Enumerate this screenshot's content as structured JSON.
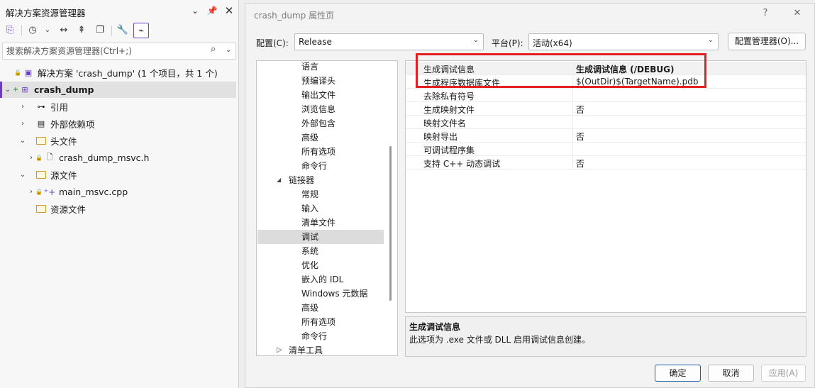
{
  "solution_explorer": {
    "title": "解决方案资源管理器",
    "header_icons": [
      "chevron-down-icon",
      "pin-icon",
      "close-icon"
    ],
    "toolbar_icons": [
      "sync-views-icon",
      "history-icon",
      "dropdown-icon",
      "back-forward-icon",
      "collapse-all-icon",
      "copy-icon",
      "properties-wrench-icon",
      "preview-selected-icon"
    ],
    "search_placeholder": "搜索解决方案资源管理器(Ctrl+;)",
    "tree": [
      {
        "label": "解决方案 'crash_dump' (1 个项目，共 1 个)"
      },
      {
        "label": "crash_dump"
      },
      {
        "label": "引用"
      },
      {
        "label": "外部依赖项"
      },
      {
        "label": "头文件"
      },
      {
        "label": "crash_dump_msvc.h"
      },
      {
        "label": "源文件"
      },
      {
        "label": "main_msvc.cpp"
      },
      {
        "label": "资源文件"
      }
    ]
  },
  "dialog": {
    "title": "crash_dump 属性页",
    "help": "?",
    "close": "✕",
    "config_label": "配置(C):",
    "config_value": "Release",
    "platform_label": "平台(P):",
    "platform_value": "活动(x64)",
    "config_manager": "配置管理器(O)...",
    "nav_items": [
      {
        "label": "语言"
      },
      {
        "label": "预编译头"
      },
      {
        "label": "输出文件"
      },
      {
        "label": "浏览信息"
      },
      {
        "label": "外部包含"
      },
      {
        "label": "高级"
      },
      {
        "label": "所有选项"
      },
      {
        "label": "命令行"
      },
      {
        "label": "链接器"
      },
      {
        "label": "常规"
      },
      {
        "label": "输入"
      },
      {
        "label": "清单文件"
      },
      {
        "label": "调试"
      },
      {
        "label": "系统"
      },
      {
        "label": "优化"
      },
      {
        "label": "嵌入的 IDL"
      },
      {
        "label": "Windows 元数据"
      },
      {
        "label": "高级"
      },
      {
        "label": "所有选项"
      },
      {
        "label": "命令行"
      },
      {
        "label": "清单工具"
      }
    ],
    "properties": [
      {
        "key": "生成调试信息",
        "value": "生成调试信息 (/DEBUG)"
      },
      {
        "key": "生成程序数据库文件",
        "value": "$(OutDir)$(TargetName).pdb"
      },
      {
        "key": "去除私有符号",
        "value": ""
      },
      {
        "key": "生成映射文件",
        "value": "否"
      },
      {
        "key": "映射文件名",
        "value": ""
      },
      {
        "key": "映射导出",
        "value": "否"
      },
      {
        "key": "可调试程序集",
        "value": ""
      },
      {
        "key": "支持 C++ 动态调试",
        "value": "否"
      }
    ],
    "desc_title": "生成调试信息",
    "desc_text": "此选项为 .exe 文件或 DLL 启用调试信息创建。",
    "ok": "确定",
    "cancel": "取消",
    "apply": "应用(A)"
  }
}
